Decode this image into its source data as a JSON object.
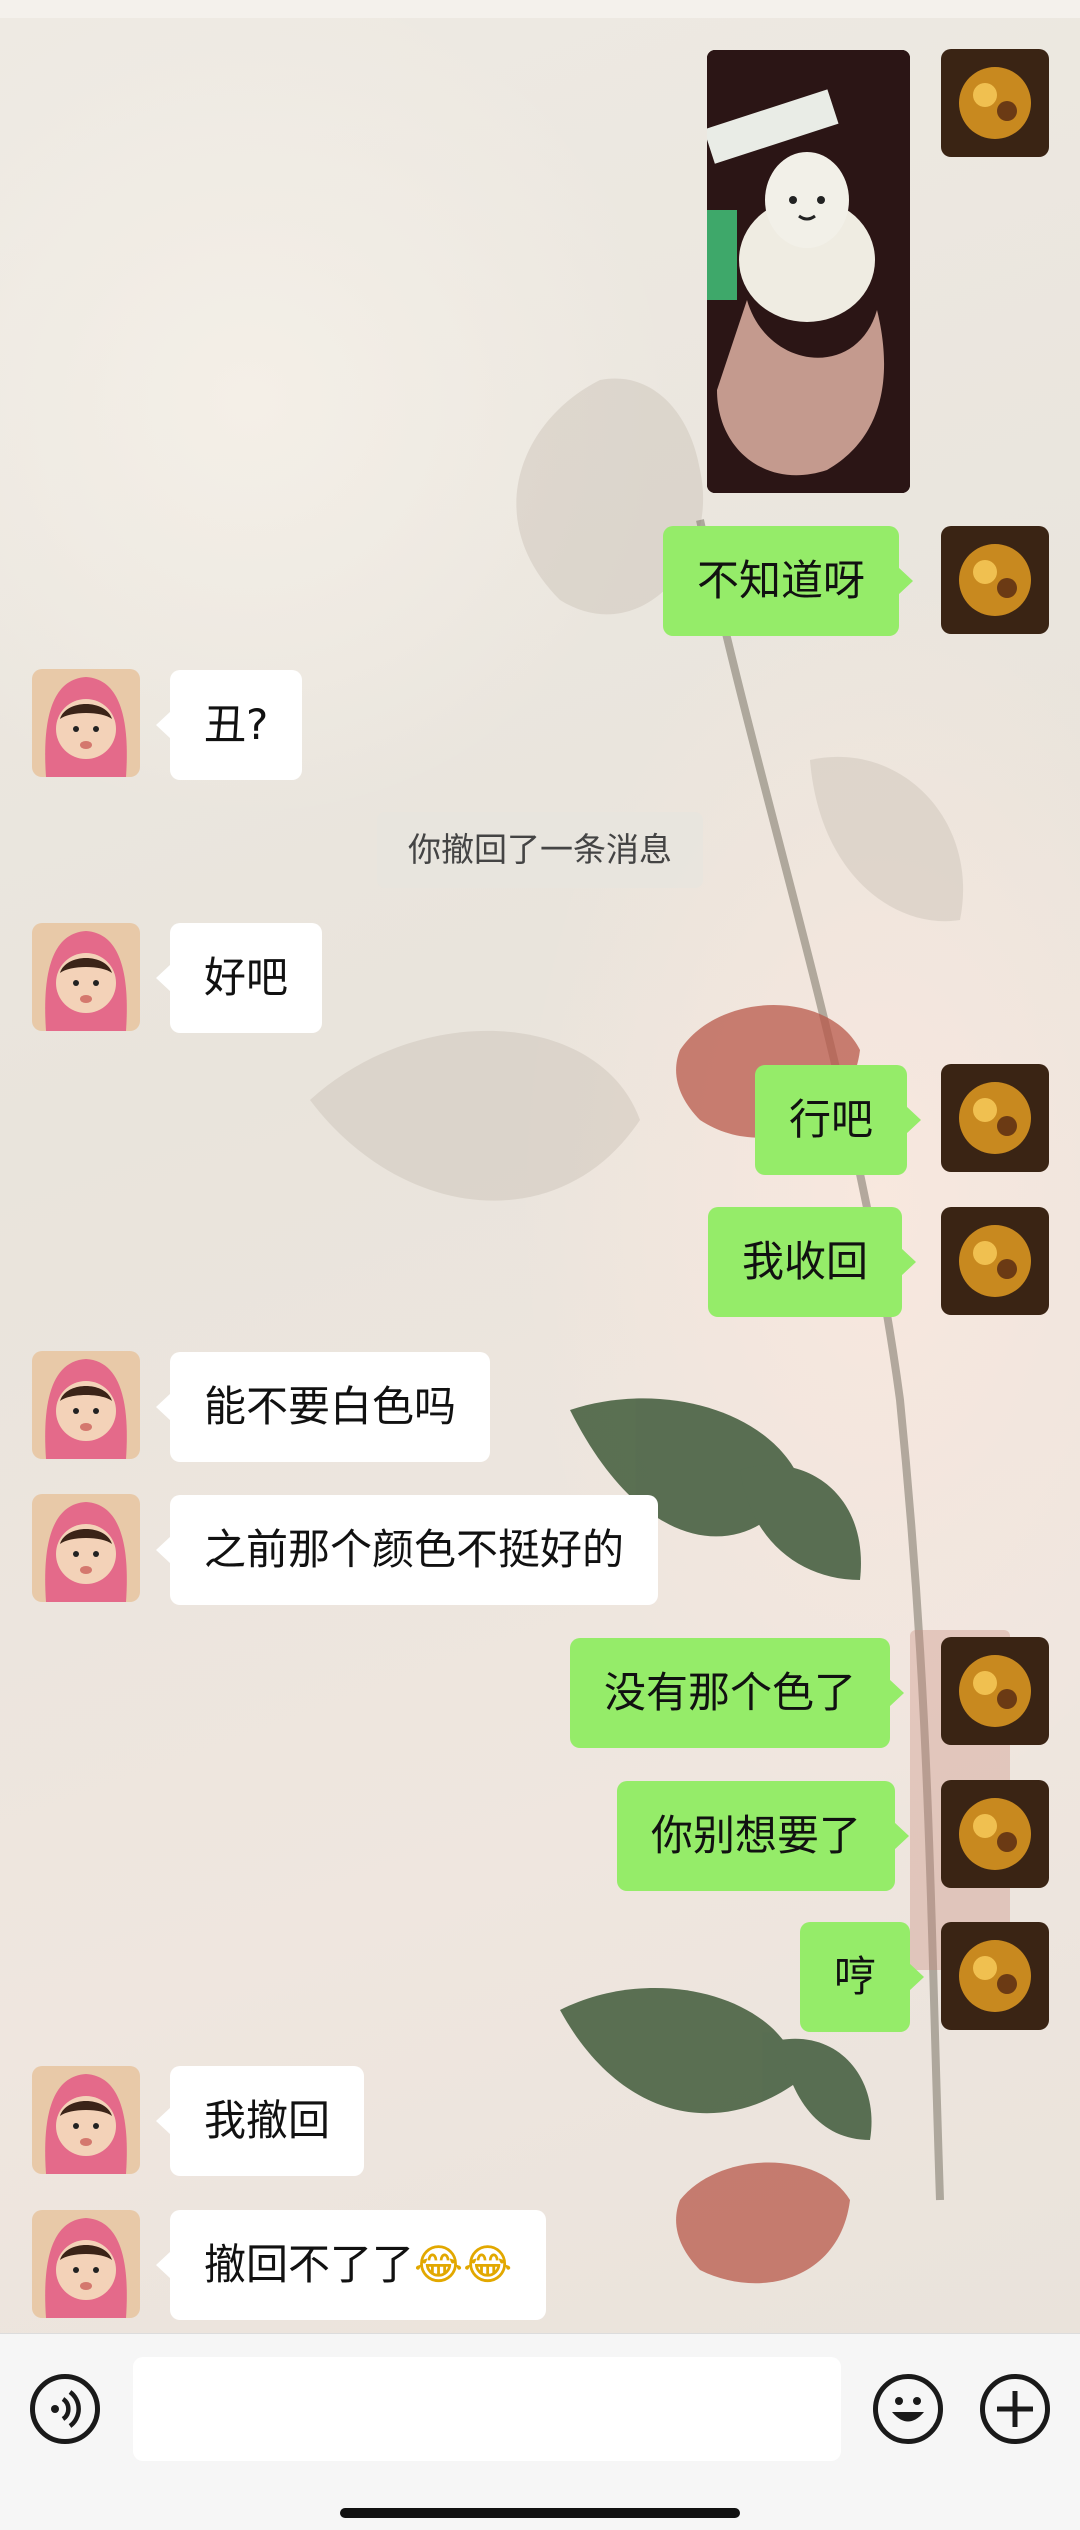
{
  "messages": [
    {
      "text": "不知道呀"
    },
    {
      "text": "丑?"
    },
    {
      "text": "好吧"
    },
    {
      "text": "行吧"
    },
    {
      "text": "我收回"
    },
    {
      "text": "能不要白色吗"
    },
    {
      "text": "之前那个颜色不挺好的"
    },
    {
      "text": "没有那个色了"
    },
    {
      "text": "你别想要了"
    },
    {
      "text": "哼"
    },
    {
      "text": "我撤回"
    },
    {
      "text": "撤回不了了",
      "emoji": "😂😂"
    }
  ],
  "system_tip": "你撤回了一条消息",
  "input_bar": {
    "placeholder": "",
    "icons": [
      "voice-icon",
      "emoji-icon",
      "plus-icon"
    ]
  },
  "colors": {
    "outgoing_bubble": "#95ec69",
    "incoming_bubble": "#ffffff",
    "text": "#111111"
  }
}
